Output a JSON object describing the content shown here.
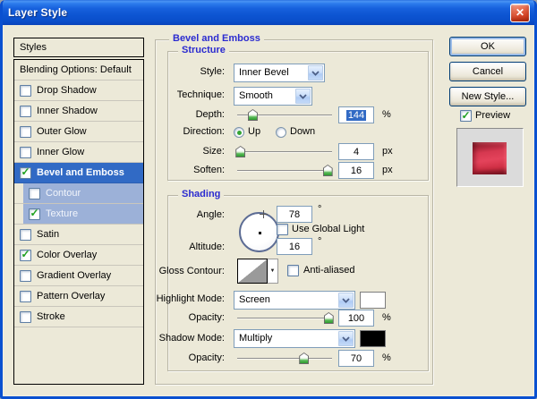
{
  "window": {
    "title": "Layer Style"
  },
  "icons": {
    "check": "✓",
    "close": "✕",
    "contour_dropdown": "▼"
  },
  "colors": {
    "selection_blue": "#316AC5",
    "sub_item_blue": "#9CB1D8",
    "label_blue": "#2B2BD0",
    "titlebar_blue": "#0A50CE",
    "highlight_swatch": "#FFFFFF",
    "shadow_swatch": "#000000",
    "preview_red": "#D93A52"
  },
  "sidebar": {
    "header": "Styles",
    "items": [
      {
        "label": "Blending Options: Default",
        "checkbox": false,
        "checked": false,
        "selected": false,
        "sub": false
      },
      {
        "label": "Drop Shadow",
        "checkbox": true,
        "checked": false,
        "selected": false,
        "sub": false
      },
      {
        "label": "Inner Shadow",
        "checkbox": true,
        "checked": false,
        "selected": false,
        "sub": false
      },
      {
        "label": "Outer Glow",
        "checkbox": true,
        "checked": false,
        "selected": false,
        "sub": false
      },
      {
        "label": "Inner Glow",
        "checkbox": true,
        "checked": false,
        "selected": false,
        "sub": false
      },
      {
        "label": "Bevel and Emboss",
        "checkbox": true,
        "checked": true,
        "selected": true,
        "sub": false
      },
      {
        "label": "Contour",
        "checkbox": true,
        "checked": false,
        "selected": false,
        "sub": true
      },
      {
        "label": "Texture",
        "checkbox": true,
        "checked": true,
        "selected": false,
        "sub": true
      },
      {
        "label": "Satin",
        "checkbox": true,
        "checked": false,
        "selected": false,
        "sub": false
      },
      {
        "label": "Color Overlay",
        "checkbox": true,
        "checked": true,
        "selected": false,
        "sub": false
      },
      {
        "label": "Gradient Overlay",
        "checkbox": true,
        "checked": false,
        "selected": false,
        "sub": false
      },
      {
        "label": "Pattern Overlay",
        "checkbox": true,
        "checked": false,
        "selected": false,
        "sub": false
      },
      {
        "label": "Stroke",
        "checkbox": true,
        "checked": false,
        "selected": false,
        "sub": false
      }
    ]
  },
  "panel": {
    "title": "Bevel and Emboss",
    "structure": {
      "title": "Structure",
      "style_label": "Style:",
      "style_value": "Inner Bevel",
      "technique_label": "Technique:",
      "technique_value": "Smooth",
      "depth_label": "Depth:",
      "depth_value": "144",
      "depth_unit": "%",
      "depth_slider_pct": 16,
      "direction_label": "Direction:",
      "direction_up": "Up",
      "direction_down": "Down",
      "direction_selected": "Up",
      "size_label": "Size:",
      "size_value": "4",
      "size_unit": "px",
      "size_slider_pct": 3,
      "soften_label": "Soften:",
      "soften_value": "16",
      "soften_unit": "px",
      "soften_slider_pct": 95
    },
    "shading": {
      "title": "Shading",
      "angle_label": "Angle:",
      "angle_value": "78",
      "angle_unit": "°",
      "use_global_light_label": "Use Global Light",
      "use_global_light_checked": false,
      "altitude_label": "Altitude:",
      "altitude_value": "16",
      "altitude_unit": "°",
      "gloss_contour_label": "Gloss Contour:",
      "anti_aliased_label": "Anti-aliased",
      "anti_aliased_checked": false,
      "highlight_mode_label": "Highlight Mode:",
      "highlight_mode_value": "Screen",
      "highlight_opacity_label": "Opacity:",
      "highlight_opacity_value": "100",
      "highlight_opacity_unit": "%",
      "highlight_opacity_slider_pct": 96,
      "shadow_mode_label": "Shadow Mode:",
      "shadow_mode_value": "Multiply",
      "shadow_opacity_label": "Opacity:",
      "shadow_opacity_value": "70",
      "shadow_opacity_unit": "%",
      "shadow_opacity_slider_pct": 70
    }
  },
  "actions": {
    "ok": "OK",
    "cancel": "Cancel",
    "new_style": "New Style...",
    "preview_label": "Preview"
  }
}
